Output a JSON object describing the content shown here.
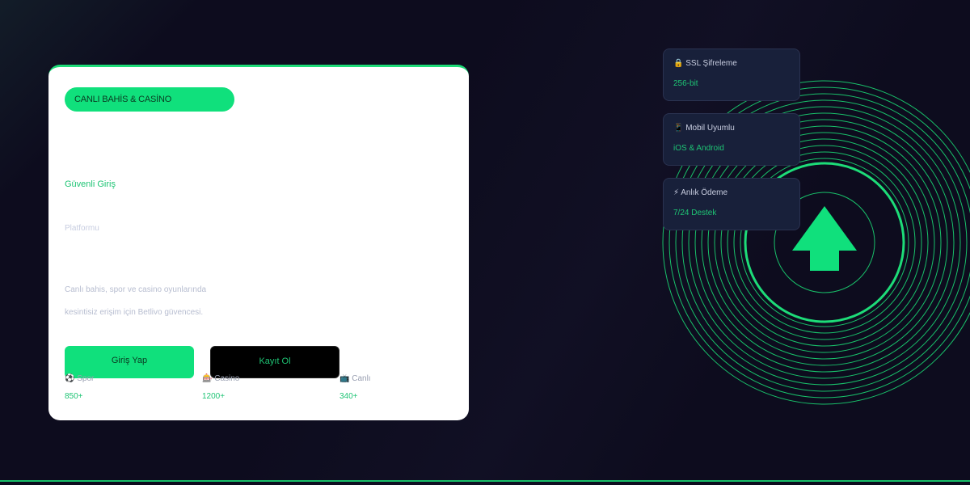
{
  "hero": {
    "badge": "CANLI BAHİS & CASİNO",
    "headline": "Güvenli Giriş",
    "subhead": "Platformu",
    "desc_line1": "Canlı bahis, spor ve casino oyunlarında",
    "desc_line2": "kesintisiz erişim için Betlivo güvencesi."
  },
  "buttons": {
    "login": "Giriş Yap",
    "register": "Kayıt Ol"
  },
  "stats": [
    {
      "label": "⚽ Spor",
      "value": "850+"
    },
    {
      "label": "🎰 Casino",
      "value": "1200+"
    },
    {
      "label": "📺 Canlı",
      "value": "340+"
    }
  ],
  "features": [
    {
      "title": "🔒 SSL Şifreleme",
      "value": "256-bit"
    },
    {
      "title": "📱 Mobil Uyumlu",
      "value": "iOS & Android"
    },
    {
      "title": "⚡ Anlık Ödeme",
      "value": "7/24 Destek"
    }
  ],
  "colors": {
    "accent": "#10e07c",
    "background": "#0d0c1e",
    "card": "#ffffff",
    "feature_card": "#18203a"
  },
  "icons": {
    "hero_graphic": "up-arrow-icon"
  }
}
